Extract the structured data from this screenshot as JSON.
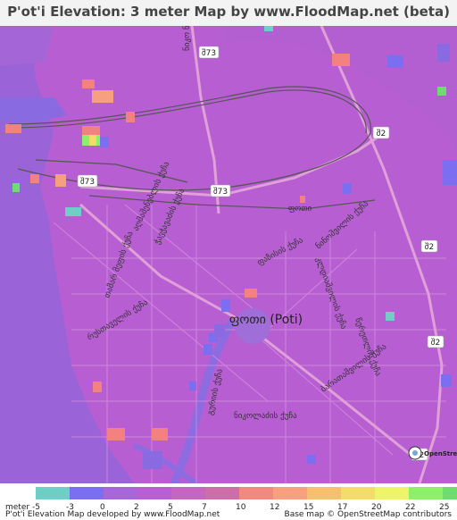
{
  "title": "P'ot'i Elevation: 3 meter Map by www.FloodMap.net (beta)",
  "city_label": "ფოთი (Poti)",
  "route_shields": [
    "შ73",
    "შ73",
    "შ73",
    "შ2",
    "შ2",
    "შ2",
    "შ2"
  ],
  "street_labels": [
    "ფოთი",
    "ნიკო ნიკოლაძის ქუჩა",
    "ფაზისის ქუჩა",
    "აღმაშენებლის ქუჩა",
    "ჭავჭავაძის ქუჩა",
    "თამარ მეფის ქუჩა",
    "ნინოშვილის ქუჩა",
    "რუსთაველის ქუჩა",
    "კლდიაშვილის ქუჩა",
    "წერეთლის ქუჩა",
    "გურიის ქუჩა",
    "ბარათაშვილის ქუჩა",
    "ფოთი",
    "ნიკოლაძის ქუჩა"
  ],
  "map_logo": "OpenStreetMap",
  "legend": {
    "unit_label": "meter",
    "ticks": [
      "-5",
      "-3",
      "0",
      "2",
      "5",
      "7",
      "10",
      "12",
      "15",
      "17",
      "20",
      "22",
      "25"
    ],
    "colors": [
      "#6fcfc7",
      "#7b6ef0",
      "#a867d8",
      "#b95fd4",
      "#c566c2",
      "#cc6fa8",
      "#f08a80",
      "#f7a080",
      "#f6c070",
      "#f4dc6c",
      "#eef46a",
      "#8ef06a",
      "#70dc70"
    ]
  },
  "credits": {
    "left": "P'ot'i Elevation Map developed by www.FloodMap.net",
    "right": "Base map © OpenStreetMap contributors"
  }
}
